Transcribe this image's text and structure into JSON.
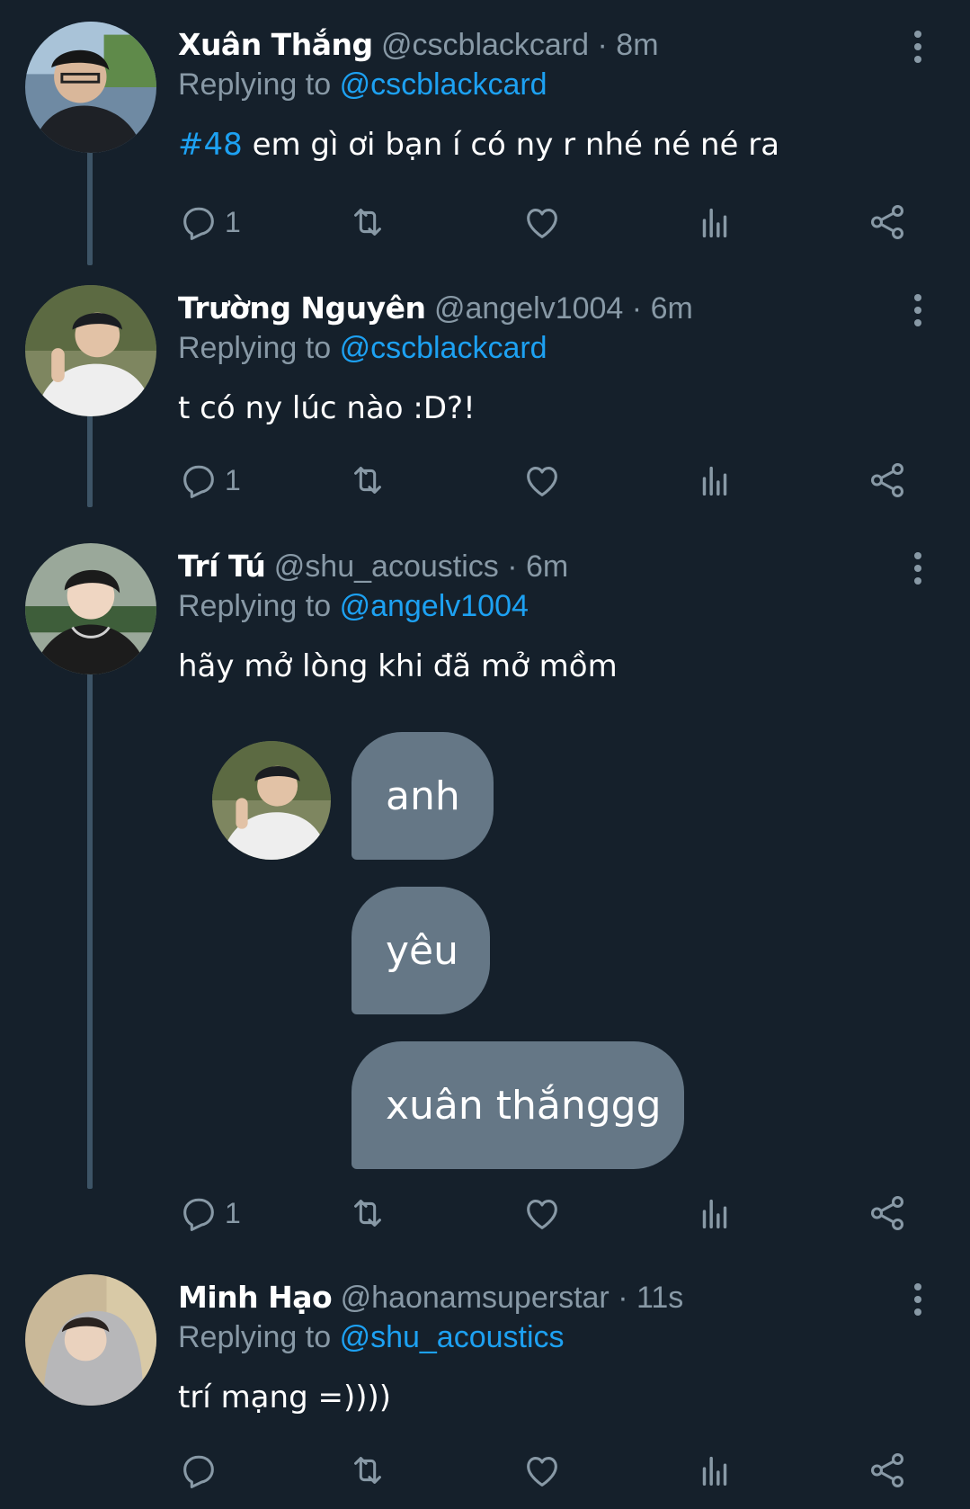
{
  "tweets": [
    {
      "name": "Xuân Thắng",
      "handle": "@cscblackcard",
      "separator": "·",
      "time": "8m",
      "replying_prefix": "Replying to",
      "replying_to": "@cscblackcard",
      "hashtag": "#48",
      "text": "em gì ơi bạn í có ny r nhé né né ra",
      "reply_count": "1"
    },
    {
      "name": "Trường Nguyên",
      "handle": "@angelv1004",
      "separator": "·",
      "time": "6m",
      "replying_prefix": "Replying to",
      "replying_to": "@cscblackcard",
      "text": "t có ny lúc nào :D?!",
      "reply_count": "1"
    },
    {
      "name": "Trí Tú",
      "handle": "@shu_acoustics",
      "separator": "·",
      "time": "6m",
      "replying_prefix": "Replying to",
      "replying_to": "@angelv1004",
      "text": "hãy mở lòng khi đã mở mồm",
      "reply_count": "1",
      "attached_chat": [
        "anh",
        "yêu",
        "xuân thắnggg"
      ]
    },
    {
      "name": "Minh Hạo",
      "handle": "@haonamsuperstar",
      "separator": "·",
      "time": "11s",
      "replying_prefix": "Replying to",
      "replying_to": "@shu_acoustics",
      "text": "trí mạng =))))",
      "reply_count": ""
    }
  ],
  "colors": {
    "background": "#15202b",
    "secondary_text": "#8899a6",
    "link": "#1da1f2",
    "bubble": "#657786"
  },
  "icons": [
    "reply-icon",
    "retweet-icon",
    "like-icon",
    "analytics-icon",
    "share-icon",
    "more-icon"
  ]
}
